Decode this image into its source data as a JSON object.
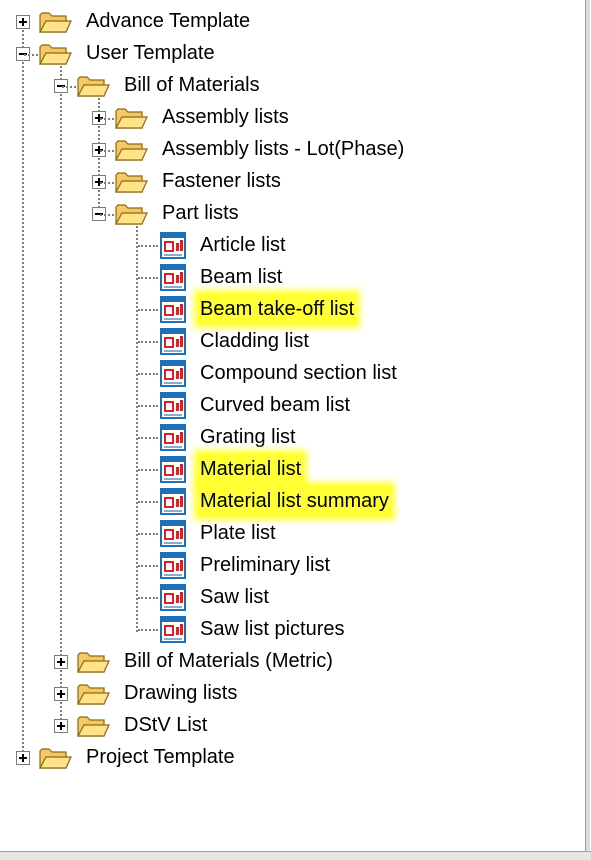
{
  "tree": {
    "advance_template": "Advance Template",
    "user_template": "User Template",
    "bill_of_materials": "Bill of Materials",
    "assembly_lists": "Assembly lists",
    "assembly_lists_lot": "Assembly lists - Lot(Phase)",
    "fastener_lists": "Fastener lists",
    "part_lists": "Part lists",
    "reports": [
      {
        "label": "Article list",
        "highlighted": false
      },
      {
        "label": "Beam list",
        "highlighted": false
      },
      {
        "label": "Beam take-off list",
        "highlighted": true
      },
      {
        "label": "Cladding list",
        "highlighted": false
      },
      {
        "label": "Compound section list",
        "highlighted": false
      },
      {
        "label": "Curved beam list",
        "highlighted": false
      },
      {
        "label": "Grating list",
        "highlighted": false
      },
      {
        "label": "Material list",
        "highlighted": true
      },
      {
        "label": "Material list summary",
        "highlighted": true
      },
      {
        "label": "Plate list",
        "highlighted": false
      },
      {
        "label": "Preliminary list",
        "highlighted": false
      },
      {
        "label": "Saw list",
        "highlighted": false
      },
      {
        "label": "Saw list pictures",
        "highlighted": false
      }
    ],
    "bill_of_materials_metric": "Bill of Materials (Metric)",
    "drawing_lists": "Drawing lists",
    "dstv_list": "DStV List",
    "project_template": "Project Template"
  },
  "colors": {
    "highlight": "#ffff33",
    "folder": "#f5c766",
    "report_icon_border": "#1f6fb5",
    "report_icon_accent": "#e02020"
  }
}
